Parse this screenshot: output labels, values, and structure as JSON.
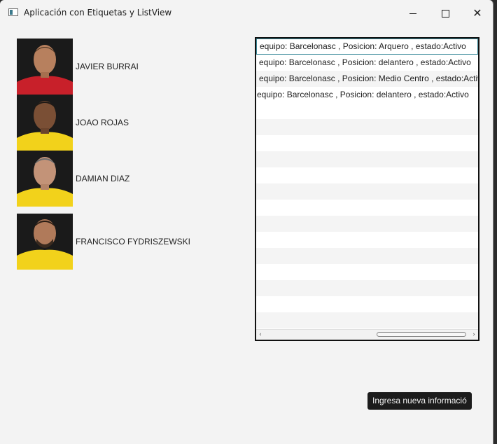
{
  "window": {
    "title": "Aplicación con Etiquetas y ListView",
    "controls": {
      "minimize_icon": "minimize-icon",
      "maximize_icon": "maximize-icon",
      "close_icon": "close-icon"
    }
  },
  "players": [
    {
      "name": "JAVIER BURRAI",
      "jersey_color": "#c8202a"
    },
    {
      "name": "JOAO ROJAS",
      "jersey_color": "#f2d21b"
    },
    {
      "name": "DAMIAN DIAZ",
      "jersey_color": "#f2d21b"
    },
    {
      "name": "FRANCISCO FYDRISZEWSKI",
      "jersey_color": "#f2d21b"
    }
  ],
  "listview": {
    "items": [
      "equipo: Barcelonasc , Posicion: Arquero , estado:Activo",
      "equipo: Barcelonasc , Posicion: delantero , estado:Activo",
      "equipo: Barcelonasc , Posicion: Medio Centro , estado:Activo",
      "equipo: Barcelonasc , Posicion: delantero , estado:Activo"
    ],
    "selected_index": 0
  },
  "action_button": {
    "label": "Ingresa nueva informació"
  },
  "colors": {
    "selection_border": "#3b8a9a",
    "button_bg": "#1c1c1c"
  }
}
